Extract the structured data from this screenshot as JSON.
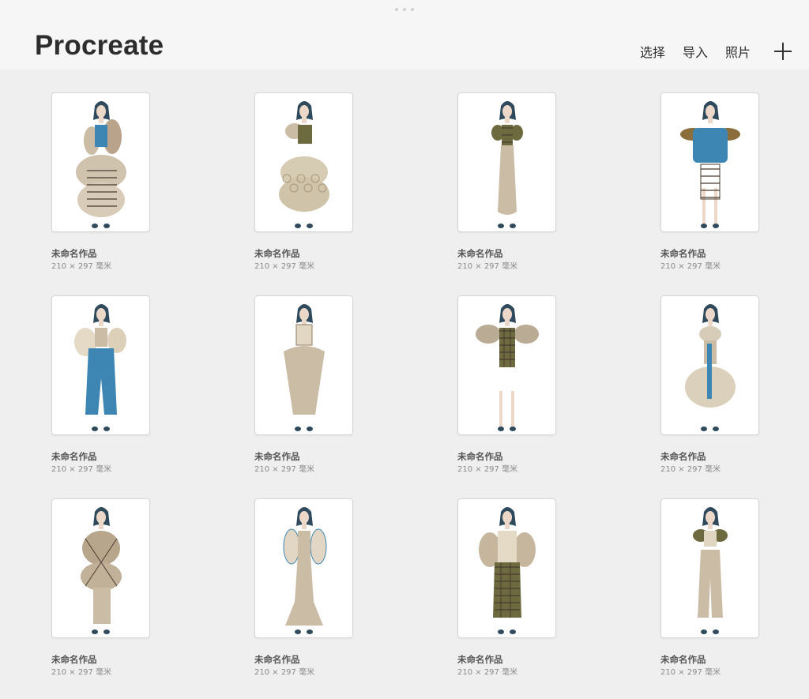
{
  "app": {
    "title": "Procreate"
  },
  "toolbar": {
    "select_label": "选择",
    "import_label": "导入",
    "photo_label": "照片",
    "add_icon": "plus-icon"
  },
  "colors": {
    "background": "#efefef",
    "header": "#f6f6f6",
    "hair": "#2f4a5c",
    "beige": "#cbbca5",
    "denim": "#3d86b4",
    "olive": "#6e6a40"
  },
  "artworks": [
    {
      "title": "未命名作品",
      "size": "210 × 297 毫米",
      "style": "beige-ruffle-gown"
    },
    {
      "title": "未命名作品",
      "size": "210 × 297 毫米",
      "style": "olive-top-ruffle-skirt"
    },
    {
      "title": "未命名作品",
      "size": "210 × 297 毫米",
      "style": "olive-puff-long-dress"
    },
    {
      "title": "未命名作品",
      "size": "210 × 297 毫米",
      "style": "blue-jacket-ruffle"
    },
    {
      "title": "未命名作品",
      "size": "210 × 297 毫米",
      "style": "blue-jeans-puff"
    },
    {
      "title": "未命名作品",
      "size": "210 × 297 毫米",
      "style": "beige-balloon-pants"
    },
    {
      "title": "未命名作品",
      "size": "210 × 297 毫米",
      "style": "plaid-ruffle-sleeves"
    },
    {
      "title": "未命名作品",
      "size": "210 × 297 毫米",
      "style": "ruffle-bubble-gown"
    },
    {
      "title": "未命名作品",
      "size": "210 × 297 毫米",
      "style": "bubble-coat-tie"
    },
    {
      "title": "未命名作品",
      "size": "210 × 297 毫米",
      "style": "beige-puff-flare"
    },
    {
      "title": "未命名作品",
      "size": "210 × 297 毫米",
      "style": "plaid-puff-coat"
    },
    {
      "title": "未命名作品",
      "size": "210 × 297 毫米",
      "style": "olive-ruffle-pants"
    }
  ]
}
